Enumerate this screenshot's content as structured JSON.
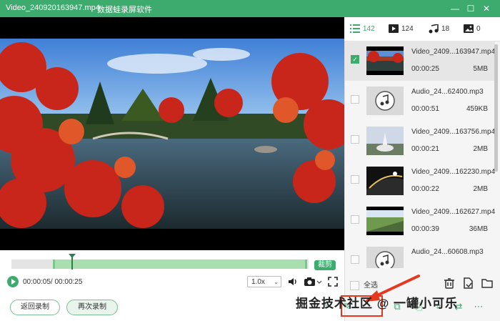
{
  "window": {
    "title": "Video_240920163947.mp4",
    "app_name": "数据蛙录屏软件",
    "accent": "#3daa6e"
  },
  "player": {
    "current_time": "00:00:05/ 00:00:25",
    "cut_label": "裁剪",
    "speed": "1.0x"
  },
  "buttons": {
    "back": "返回录制",
    "again": "再次录制"
  },
  "tabs": [
    {
      "icon": "list-icon",
      "count": "142"
    },
    {
      "icon": "video-icon",
      "count": "124"
    },
    {
      "icon": "music-icon",
      "count": "18"
    },
    {
      "icon": "image-icon",
      "count": "0"
    }
  ],
  "files": [
    {
      "name": "Video_2409...163947.mp4",
      "duration": "00:00:25",
      "size": "5MB",
      "type": "video",
      "selected": true
    },
    {
      "name": "Audio_24...62400.mp3",
      "duration": "00:00:51",
      "size": "459KB",
      "type": "audio",
      "selected": false
    },
    {
      "name": "Video_2409...163756.mp4",
      "duration": "00:00:21",
      "size": "2MB",
      "type": "video",
      "selected": false
    },
    {
      "name": "Video_2409...162230.mp4",
      "duration": "00:00:22",
      "size": "2MB",
      "type": "video",
      "selected": false
    },
    {
      "name": "Video_2409...162627.mp4",
      "duration": "00:00:39",
      "size": "36MB",
      "type": "video",
      "selected": false
    },
    {
      "name": "Audio_24...60608.mp3",
      "duration": "",
      "size": "",
      "type": "audio",
      "selected": false
    }
  ],
  "select_all": "全选",
  "watermark": "掘金技术社区 @ 一罐小可乐",
  "timeline": {
    "selection_start": 0.14,
    "selection_end": 1.0,
    "playhead": 0.2
  }
}
